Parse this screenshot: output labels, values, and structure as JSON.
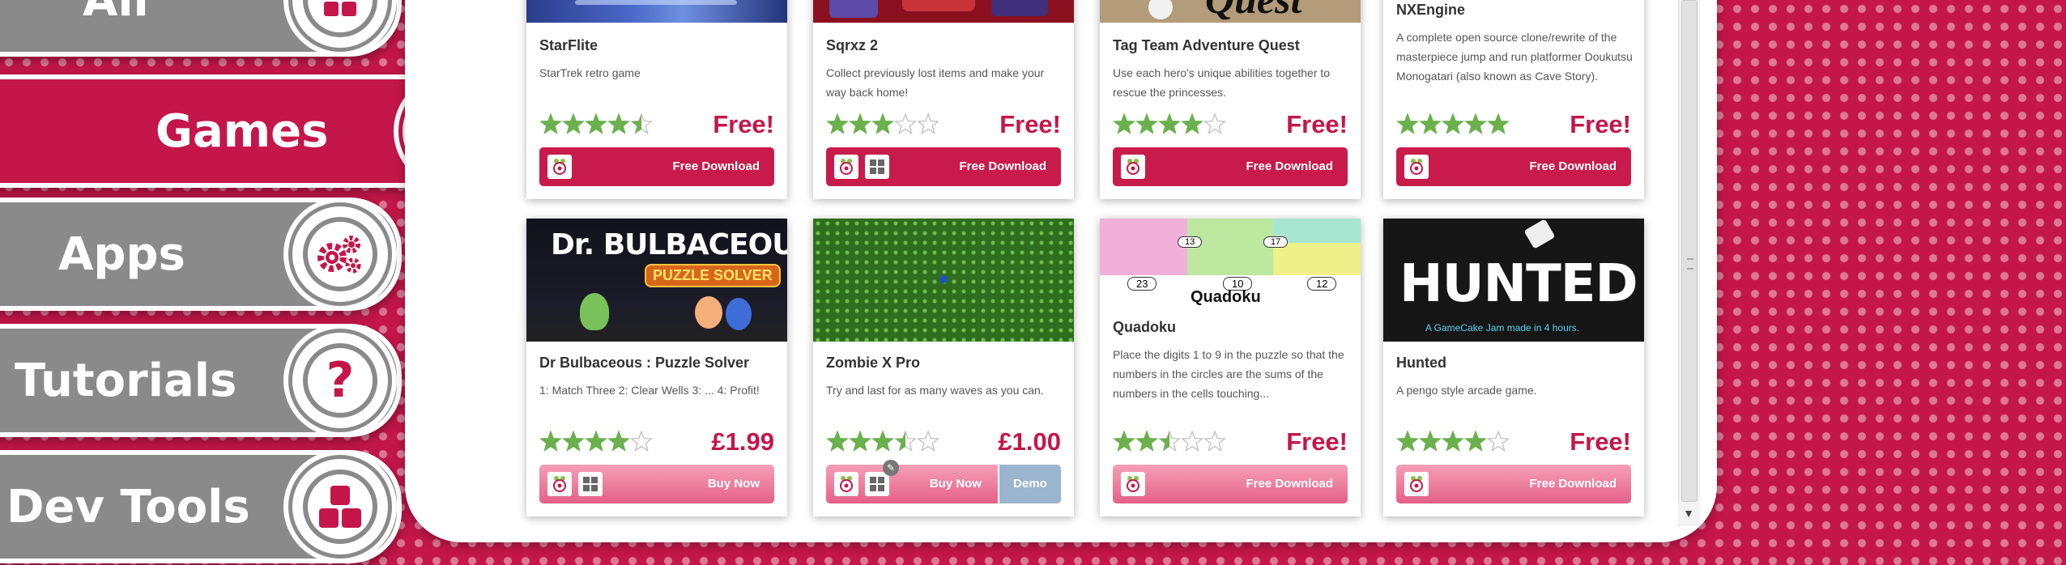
{
  "sidebar": {
    "items": [
      {
        "label": "All",
        "icon": "grid-squares-icon",
        "active": false
      },
      {
        "label": "Games",
        "icon": "pawn-icon",
        "active": true
      },
      {
        "label": "Apps",
        "icon": "gears-icon",
        "active": false
      },
      {
        "label": "Tutorials",
        "icon": "question-icon",
        "active": false
      },
      {
        "label": "Dev Tools",
        "icon": "blocks-icon",
        "active": false
      }
    ]
  },
  "thumbs": {
    "quest_word": "Quest",
    "bulbaceous_title": "Dr. BULBACEOUS",
    "bulbaceous_sub": "PUZZLE SOLVER",
    "quadoku_word": "Quadoku",
    "quadoku_nums": [
      "13",
      "17",
      "23",
      "10",
      "12"
    ],
    "hunted_title": "HUNTED",
    "hunted_sub": "A GameCake Jam made in 4 hours."
  },
  "cards": [
    {
      "title": "StarFlite",
      "description": "StarTrek retro game",
      "rating": 4.5,
      "price": "Free!",
      "button": "Free Download",
      "platforms": [
        "raspberry-icon"
      ]
    },
    {
      "title": "Sqrxz 2",
      "description": "Collect previously lost items and make your way back home!",
      "rating": 3,
      "price": "Free!",
      "button": "Free Download",
      "platforms": [
        "raspberry-icon",
        "windows-icon"
      ]
    },
    {
      "title": "Tag Team Adventure Quest",
      "description": "Use each hero's unique abilities together to rescue the princesses.",
      "rating": 4,
      "price": "Free!",
      "button": "Free Download",
      "platforms": [
        "raspberry-icon"
      ]
    },
    {
      "title": "NXEngine",
      "description": "A complete open source clone/rewrite of the masterpiece jump and run platformer Doukutsu Monogatari (also known as Cave Story).",
      "rating": 5,
      "price": "Free!",
      "button": "Free Download",
      "platforms": [
        "raspberry-icon"
      ]
    },
    {
      "title": "Dr Bulbaceous : Puzzle Solver",
      "description": "1: Match Three 2: Clear Wells 3: ... 4: Profit!",
      "rating": 4,
      "price": "£1.99",
      "button": "Buy Now",
      "platforms": [
        "raspberry-icon",
        "windows-icon"
      ]
    },
    {
      "title": "Zombie X Pro",
      "description": "Try and last for as many waves as you can.",
      "rating": 3.5,
      "price": "£1.00",
      "button": "Buy Now",
      "demo": "Demo",
      "platforms": [
        "raspberry-icon",
        "windows-icon"
      ]
    },
    {
      "title": "Quadoku",
      "description": "Place the digits 1 to 9 in the puzzle so that the numbers in the circles are the sums of the numbers in the cells touching...",
      "rating": 2.5,
      "price": "Free!",
      "button": "Free Download",
      "platforms": [
        "raspberry-icon"
      ]
    },
    {
      "title": "Hunted",
      "description": "A pengo style arcade game.",
      "rating": 4,
      "price": "Free!",
      "button": "Free Download",
      "platforms": [
        "raspberry-icon"
      ]
    }
  ],
  "colors": {
    "brand": "#c4164a",
    "nav_inactive": "#8a8a8a",
    "star_fill": "#6ab04c",
    "demo": "#9ab5cd"
  }
}
